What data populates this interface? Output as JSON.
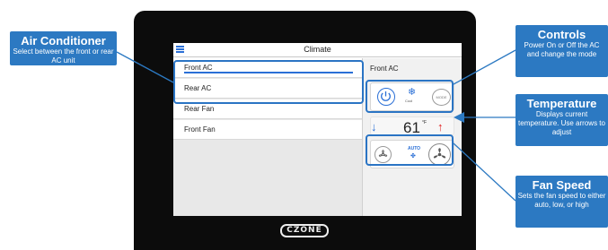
{
  "app": {
    "title": "Climate"
  },
  "device": {
    "brand": "CZONE"
  },
  "sidebar": {
    "items": [
      {
        "label": "Front AC",
        "selected": true
      },
      {
        "label": "Rear AC",
        "selected": false
      },
      {
        "label": "Rear Fan",
        "selected": false
      },
      {
        "label": "Front Fan",
        "selected": false
      }
    ]
  },
  "panel": {
    "title": "Front AC",
    "controls": {
      "mode_button": "MODE",
      "mode_label": "Cool",
      "mode_icon": "snowflake-icon"
    },
    "temperature": {
      "value": "61",
      "unit": "°F"
    },
    "fan": {
      "auto_label": "AUTO"
    }
  },
  "callouts": {
    "air_conditioner": {
      "title": "Air Conditioner",
      "text": "Select between the front or rear AC unit"
    },
    "controls": {
      "title": "Controls",
      "text": "Power On or Off the AC and change the mode"
    },
    "temperature": {
      "title": "Temperature",
      "text": "Displays current temperature. Use arrows to adjust"
    },
    "fan_speed": {
      "title": "Fan Speed",
      "text": "Sets the fan speed to either auto, low, or high"
    }
  },
  "colors": {
    "accent": "#2c79c2",
    "up_arrow": "#e02020",
    "bezel": "#0c0c0c"
  }
}
